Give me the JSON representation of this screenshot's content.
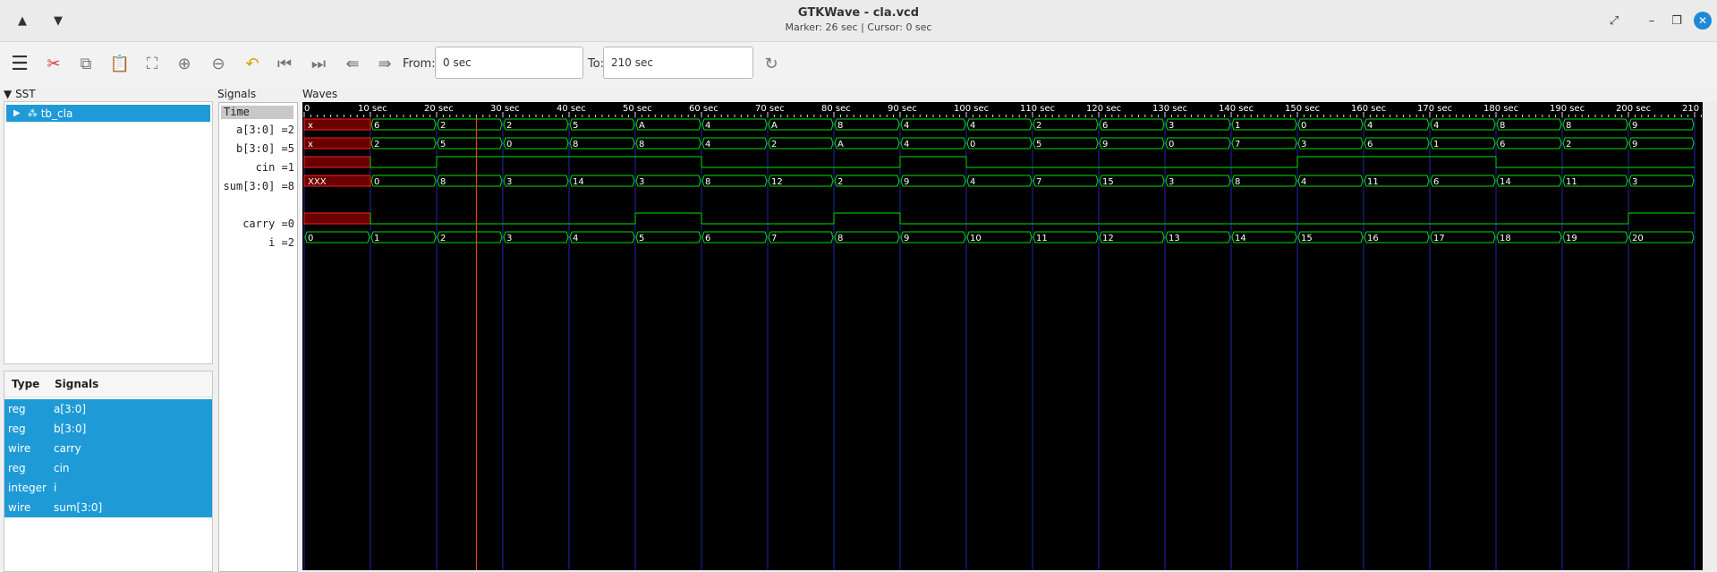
{
  "window": {
    "title": "GTKWave - cla.vcd",
    "subtitle": "Marker: 26 sec  |  Cursor: 0 sec"
  },
  "toolbar": {
    "from_label": "From:",
    "from_value": "0 sec",
    "to_label": "To:",
    "to_value": "210 sec"
  },
  "sst": {
    "label": "SST",
    "tree_item": "tb_cla",
    "table_headers": [
      "Type",
      "Signals"
    ],
    "signals": [
      {
        "type": "reg",
        "name": "a[3:0]"
      },
      {
        "type": "reg",
        "name": "b[3:0]"
      },
      {
        "type": "wire",
        "name": "carry"
      },
      {
        "type": "reg",
        "name": "cin"
      },
      {
        "type": "integer",
        "name": "i"
      },
      {
        "type": "wire",
        "name": "sum[3:0]"
      }
    ]
  },
  "signals_panel": {
    "label": "Signals",
    "time_header": "Time",
    "names": [
      "a[3:0] =2",
      "b[3:0] =5",
      "cin =1",
      "sum[3:0] =8",
      "",
      "carry =0",
      "i =2"
    ]
  },
  "waves_panel": {
    "label": "Waves",
    "ticks": [
      "0",
      "10 sec",
      "20 sec",
      "30 sec",
      "40 sec",
      "50 sec",
      "60 sec",
      "70 sec",
      "80 sec",
      "90 sec",
      "100 sec",
      "110 sec",
      "120 sec",
      "130 sec",
      "140 sec",
      "150 sec",
      "160 sec",
      "170 sec",
      "180 sec",
      "190 sec",
      "200 sec",
      "210 sec"
    ],
    "marker_time": 26,
    "range": [
      0,
      210
    ],
    "colors": {
      "wave": "#00e000",
      "undefined": "#ff2020",
      "grid": "#1a2aa8",
      "marker": "#ff4a20",
      "background": "#000000"
    },
    "buses": [
      {
        "row": 0,
        "values": [
          "x",
          "6",
          "2",
          "2",
          "5",
          "A",
          "4",
          "A",
          "8",
          "4",
          "4",
          "2",
          "6",
          "3",
          "1",
          "0",
          "4",
          "4",
          "8",
          "8",
          "9"
        ]
      },
      {
        "row": 1,
        "values": [
          "x",
          "2",
          "5",
          "0",
          "8",
          "8",
          "4",
          "2",
          "A",
          "4",
          "0",
          "5",
          "9",
          "0",
          "7",
          "3",
          "6",
          "1",
          "6",
          "2",
          "9"
        ]
      },
      {
        "row": 3,
        "values": [
          "XXX",
          "0",
          "8",
          "3",
          "14",
          "3",
          "8",
          "12",
          "2",
          "9",
          "4",
          "7",
          "15",
          "3",
          "8",
          "4",
          "11",
          "6",
          "14",
          "11",
          "3"
        ]
      },
      {
        "row": 6,
        "values": [
          "0",
          "1",
          "2",
          "3",
          "4",
          "5",
          "6",
          "7",
          "8",
          "9",
          "10",
          "11",
          "12",
          "13",
          "14",
          "15",
          "16",
          "17",
          "18",
          "19",
          "20"
        ]
      }
    ],
    "bits": [
      {
        "row": 2,
        "levels": [
          "x",
          0,
          1,
          1,
          1,
          1,
          0,
          0,
          0,
          1,
          0,
          0,
          0,
          0,
          0,
          1,
          1,
          1,
          0,
          0,
          0
        ]
      },
      {
        "row": 5,
        "levels": [
          "x",
          0,
          0,
          0,
          0,
          1,
          0,
          0,
          1,
          0,
          0,
          0,
          0,
          0,
          0,
          0,
          0,
          0,
          0,
          0,
          1
        ]
      }
    ]
  }
}
